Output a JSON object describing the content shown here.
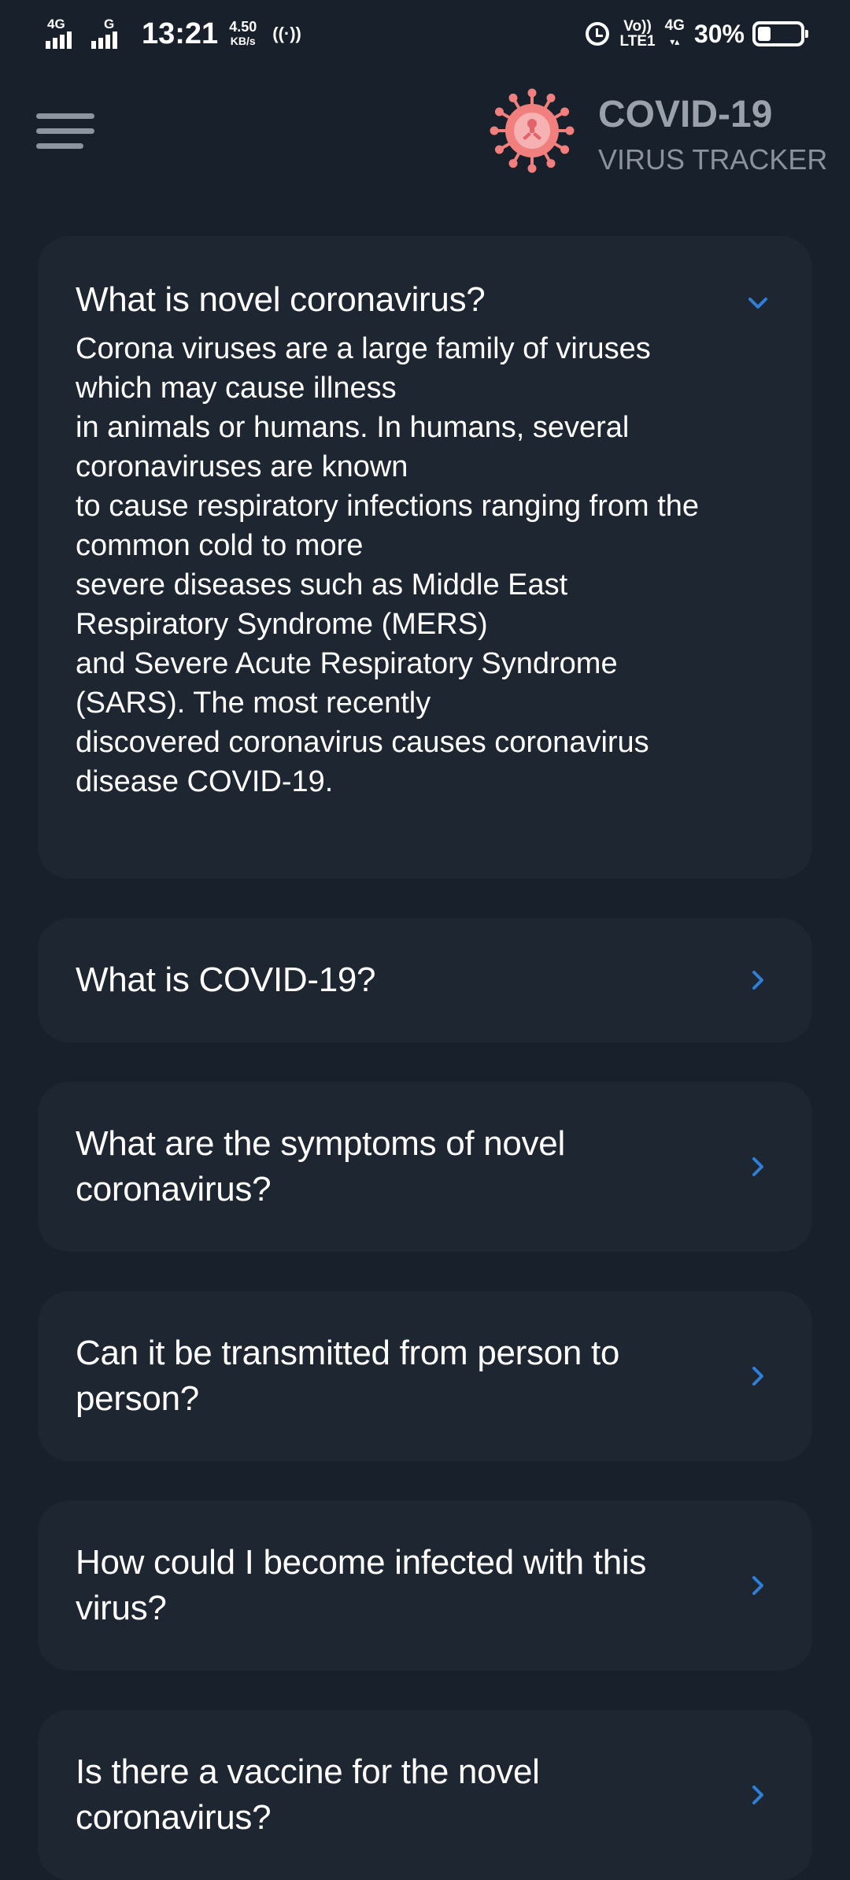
{
  "status_bar": {
    "sim1_network": "4G",
    "sim2_network": "G",
    "time": "13:21",
    "speed_value": "4.50",
    "speed_unit": "KB/s",
    "hotspot_icon": "hotspot-icon",
    "alarm_icon": "alarm-icon",
    "volte_top": "Vo))",
    "volte_bottom": "LTE1",
    "data_network": "4G",
    "battery_percent": "30%",
    "battery_level": 0.3
  },
  "header": {
    "menu_icon": "hamburger-menu-icon",
    "logo_icon": "virus-icon",
    "logo_color": "#f07f7d",
    "title": "COVID-19",
    "subtitle": "VIRUS TRACKER"
  },
  "faq": {
    "accent_color": "#2f7fd8",
    "items": [
      {
        "question": "What is novel coronavirus?",
        "expanded": true,
        "answer": "Corona viruses are a large family of viruses\nwhich may cause illness\nin animals or humans. In humans, several\ncoronaviruses are known\nto cause respiratory infections ranging from the\ncommon cold to more\nsevere diseases such as Middle East\nRespiratory Syndrome (MERS)\nand Severe Acute Respiratory Syndrome\n(SARS). The most recently\ndiscovered coronavirus causes coronavirus\ndisease COVID-19."
      },
      {
        "question": "What is COVID-19?",
        "expanded": false
      },
      {
        "question": "What are the symptoms of novel coronavirus?",
        "expanded": false
      },
      {
        "question": "Can it be transmitted from person to person?",
        "expanded": false
      },
      {
        "question": "How could I become infected with this virus?",
        "expanded": false
      },
      {
        "question": "Is there a vaccine for the novel coronavirus?",
        "expanded": false
      }
    ]
  }
}
